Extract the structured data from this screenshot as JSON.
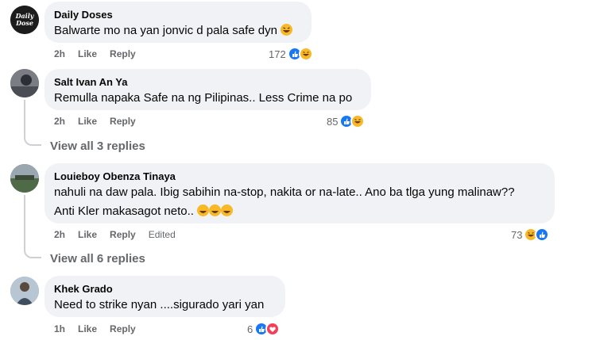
{
  "comments": [
    {
      "author": "Daily Doses",
      "text": "Balwarte mo na yan jonvic d pala safe dyn",
      "time": "2h",
      "like": "Like",
      "reply": "Reply",
      "reactions": "172",
      "avatar_text": "Daily Dose"
    },
    {
      "author": "Salt Ivan An Ya",
      "text": "Remulla napaka Safe na ng Pilipinas.. Less Crime na po",
      "time": "2h",
      "like": "Like",
      "reply": "Reply",
      "reactions": "85",
      "view_replies": "View all 3 replies"
    },
    {
      "author": "Louieboy Obenza Tinaya",
      "text_line1": "nahuli na daw pala. Ibig sabihin na-stop, nakita or na-late.. Ano ba tlga yung malinaw??",
      "text_line2": "Anti Kler makasagot neto..",
      "time": "2h",
      "like": "Like",
      "reply": "Reply",
      "edited": "Edited",
      "reactions": "73",
      "view_replies": "View all 6 replies"
    },
    {
      "author": "Khek Grado",
      "text": "Need to strike nyan ....sigurado yari yan",
      "time": "1h",
      "like": "Like",
      "reply": "Reply",
      "reactions": "6"
    }
  ],
  "colors": {
    "bubble": "#f0f2f5",
    "like": "#1877f2",
    "haha": "#f7b928",
    "love": "#f33e58",
    "secondary": "#65676b"
  }
}
